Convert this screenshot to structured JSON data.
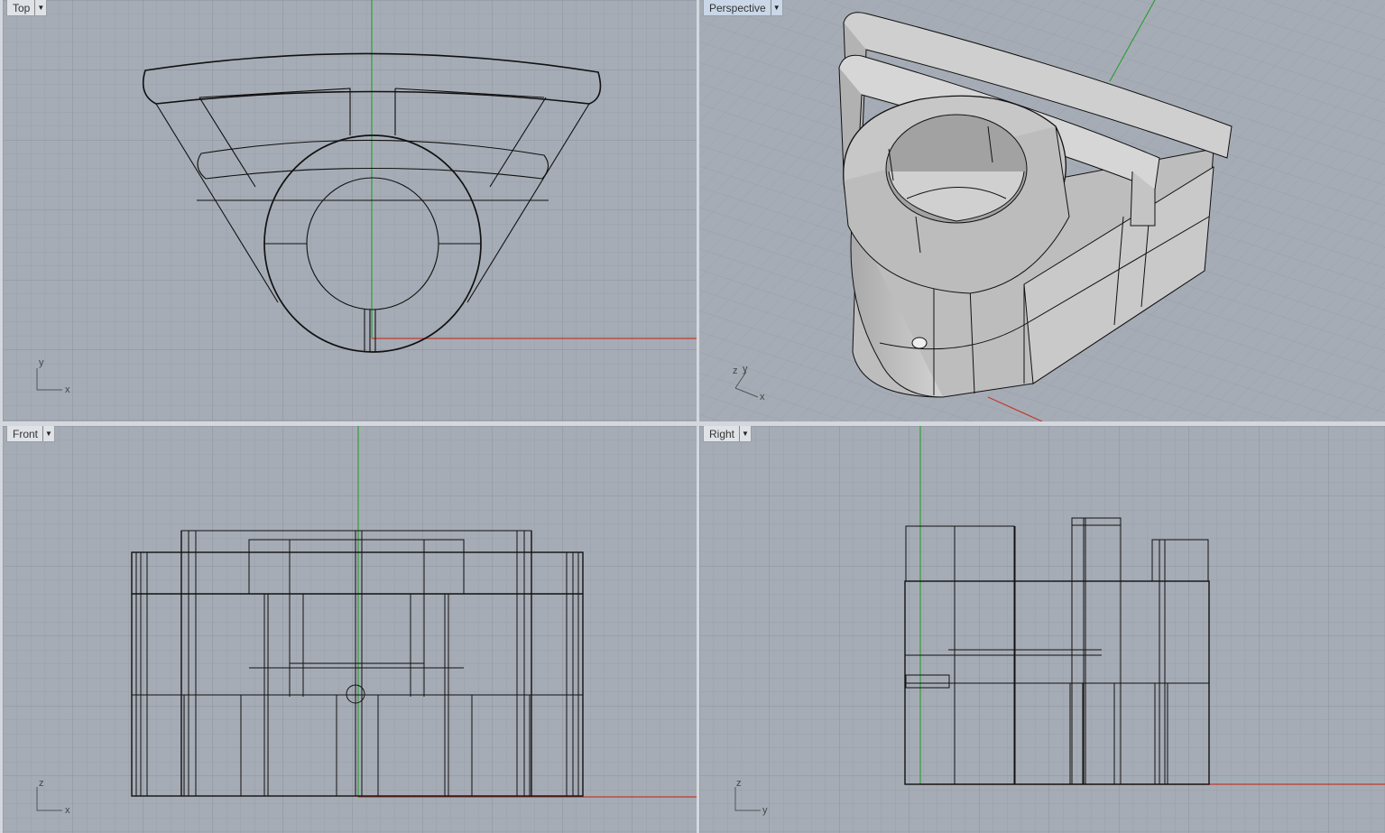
{
  "viewports": {
    "top": {
      "label": "Top",
      "axis_v": "y",
      "axis_h": "x"
    },
    "persp": {
      "label": "Perspective",
      "axis_v": "y",
      "axis_z": "z",
      "axis_h": "x"
    },
    "front": {
      "label": "Front",
      "axis_v": "z",
      "axis_h": "x"
    },
    "right": {
      "label": "Right",
      "axis_v": "z",
      "axis_h": "y"
    }
  },
  "icons": {
    "dropdown": "chevron-down-icon"
  },
  "colors": {
    "background": "#a6acb5",
    "grid_minor": "#9aa0a9",
    "grid_major": "#8c929b",
    "x_axis": "#c0392b",
    "y_axis": "#2e9e3a",
    "wire": "#111111",
    "surface": "#c6c6c6"
  }
}
